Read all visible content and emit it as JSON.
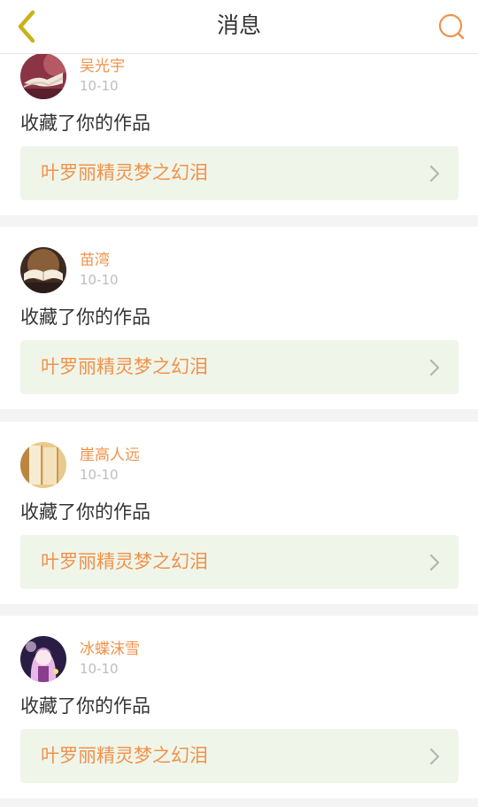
{
  "header": {
    "title": "消息",
    "back_icon": "chevron-left-icon",
    "search_icon": "search-icon",
    "accent": "#f0924a",
    "back_color": "#c9b21a"
  },
  "messages": [
    {
      "user": "吴光宇",
      "date": "10-10",
      "action": "收藏了你的作品",
      "work": "叶罗丽精灵梦之幻泪",
      "avatar": "book-avatar"
    },
    {
      "user": "苗湾",
      "date": "10-10",
      "action": "收藏了你的作品",
      "work": "叶罗丽精灵梦之幻泪",
      "avatar": "book-avatar"
    },
    {
      "user": "崖高人远",
      "date": "10-10",
      "action": "收藏了你的作品",
      "work": "叶罗丽精灵梦之幻泪",
      "avatar": "books-avatar"
    },
    {
      "user": "冰蝶沫雪",
      "date": "10-10",
      "action": "收藏了你的作品",
      "work": "叶罗丽精灵梦之幻泪",
      "avatar": "anime-avatar"
    }
  ]
}
